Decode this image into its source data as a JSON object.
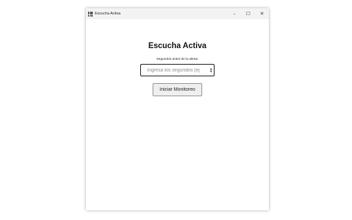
{
  "window": {
    "title": "Escucha Activa",
    "app_icon": "grid-app-icon",
    "controls": {
      "minimize": "–",
      "maximize": "☐",
      "close": "✕"
    }
  },
  "main": {
    "heading": "Escucha Activa",
    "seconds_label": "Segundos antes de la alerta:",
    "seconds_input": {
      "value": "",
      "placeholder": "Ingresa los segundos (ej"
    },
    "start_button_label": "Iniciar Monitoreo"
  }
}
